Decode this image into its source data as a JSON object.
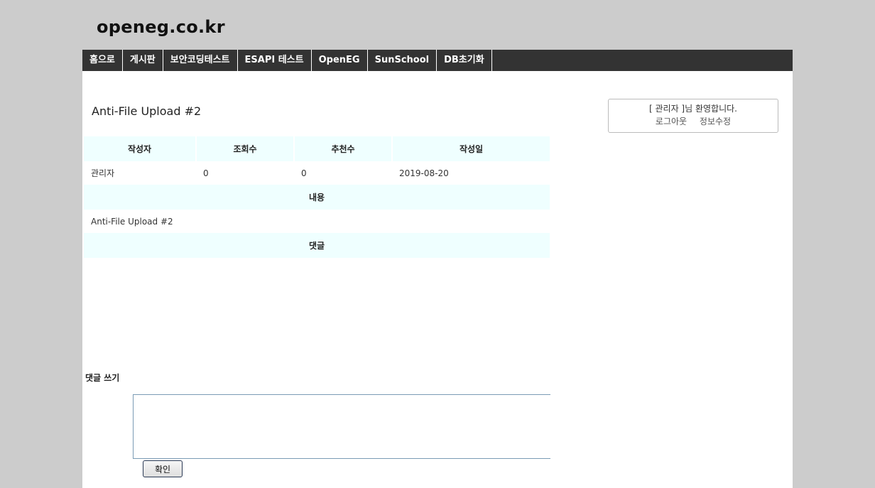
{
  "site": {
    "title": "openeg.co.kr"
  },
  "nav": {
    "items": [
      "홈으로",
      "게시판",
      "보안코딩테스트",
      "ESAPI 테스트",
      "OpenEG",
      "SunSchool",
      "DB초기화"
    ]
  },
  "post": {
    "title": "Anti-File Upload #2",
    "headers": {
      "author": "작성자",
      "views": "조회수",
      "recommends": "추천수",
      "date": "작성일"
    },
    "values": {
      "author": "관리자",
      "views": "0",
      "recommends": "0",
      "date": "2019-08-20"
    },
    "content_header": "내용",
    "content": "Anti-File Upload #2",
    "comments_header": "댓글"
  },
  "welcome": {
    "message": "[ 관리자 ]님 환영합니다.",
    "logout_label": "로그아웃",
    "edit_profile_label": "정보수정"
  },
  "reply": {
    "label": "댓글 쓰기",
    "textarea_value": "",
    "submit_label": "확인"
  }
}
